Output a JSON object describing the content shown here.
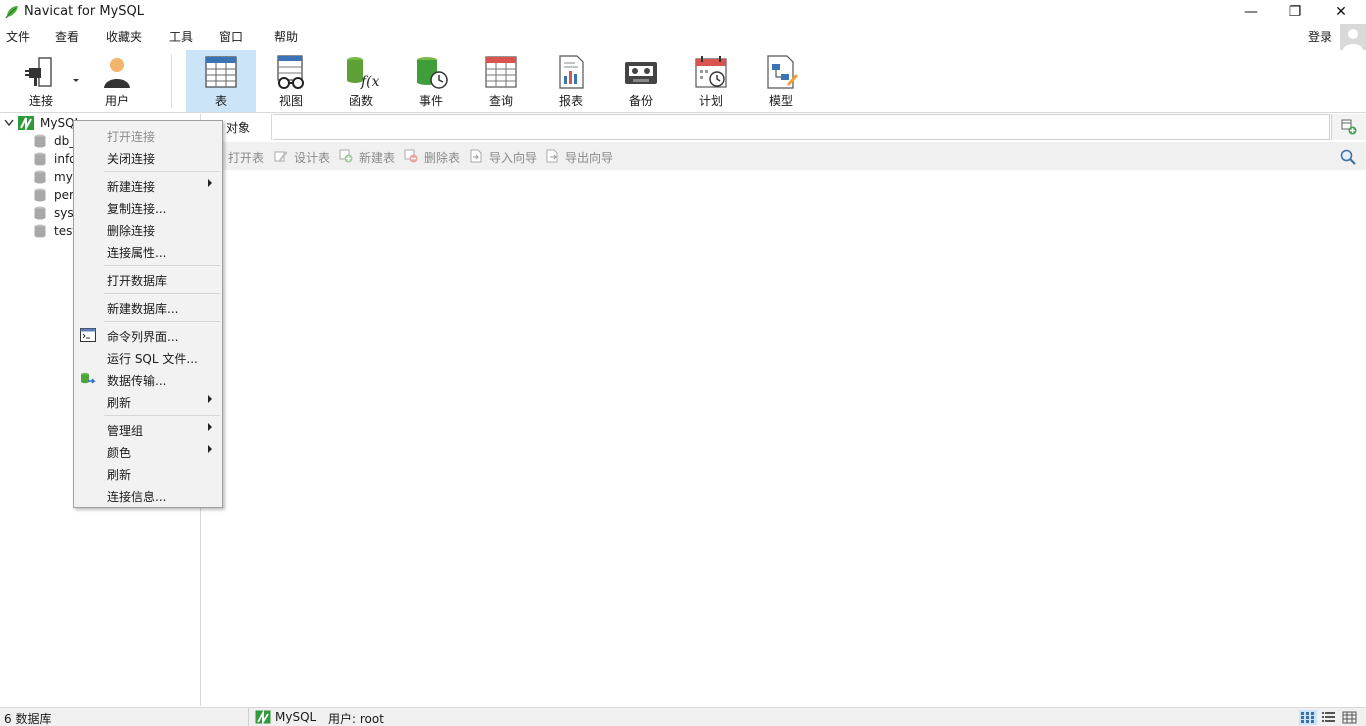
{
  "window": {
    "title": "Navicat for MySQL",
    "minimize_glyph": "—",
    "restore_glyph": "❐",
    "close_glyph": "✕"
  },
  "menubar": {
    "items": [
      "文件",
      "查看",
      "收藏夹",
      "工具",
      "窗口",
      "帮助"
    ],
    "login": "登录"
  },
  "toolbar": {
    "tools": [
      {
        "label": "连接",
        "icon": "connection-plug-icon"
      },
      {
        "label": "用户",
        "icon": "user-icon"
      },
      {
        "label": "表",
        "icon": "table-icon"
      },
      {
        "label": "视图",
        "icon": "view-glasses-icon"
      },
      {
        "label": "函数",
        "icon": "function-icon"
      },
      {
        "label": "事件",
        "icon": "event-clock-icon"
      },
      {
        "label": "查询",
        "icon": "query-icon"
      },
      {
        "label": "报表",
        "icon": "report-icon"
      },
      {
        "label": "备份",
        "icon": "backup-icon"
      },
      {
        "label": "计划",
        "icon": "schedule-calendar-icon"
      },
      {
        "label": "模型",
        "icon": "model-icon"
      }
    ],
    "active": "表"
  },
  "tree": {
    "connection": "MySQL",
    "databases": [
      "db_",
      "info",
      "mys",
      "per",
      "sys",
      "test"
    ]
  },
  "objects_tab": {
    "label": "对象"
  },
  "subtoolbar": {
    "items": [
      "打开表",
      "设计表",
      "新建表",
      "删除表",
      "导入向导",
      "导出向导"
    ]
  },
  "context_menu": {
    "items": [
      {
        "label": "打开连接",
        "disabled": true
      },
      {
        "label": "关闭连接"
      },
      {
        "label": "新建连接",
        "submenu": true
      },
      {
        "label": "复制连接..."
      },
      {
        "label": "删除连接"
      },
      {
        "label": "连接属性..."
      },
      {
        "label": "打开数据库"
      },
      {
        "label": "新建数据库..."
      },
      {
        "label": "命令列界面...",
        "icon": "console-icon"
      },
      {
        "label": "运行 SQL 文件..."
      },
      {
        "label": "数据传输...",
        "icon": "data-transfer-icon"
      },
      {
        "label": "刷新",
        "submenu": true
      },
      {
        "label": "管理组",
        "submenu": true
      },
      {
        "label": "颜色",
        "submenu": true
      },
      {
        "label": "刷新"
      },
      {
        "label": "连接信息..."
      }
    ]
  },
  "statusbar": {
    "db_count": "6 数据库",
    "connection": "MySQL",
    "user": "用户: root"
  },
  "colors": {
    "mysql_green": "#2e9a3a",
    "toolbar_active": "#cce4f7",
    "db_gray": "#a8a8a8"
  }
}
